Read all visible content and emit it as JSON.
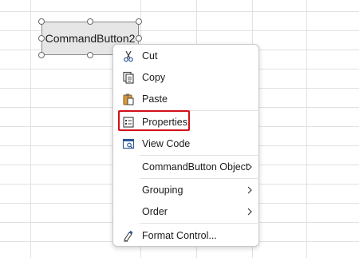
{
  "command_button": {
    "label": "CommandButton2"
  },
  "context_menu": {
    "items": [
      {
        "label": "Cut",
        "icon": "scissors-icon"
      },
      {
        "label": "Copy",
        "icon": "copy-icon"
      },
      {
        "label": "Paste",
        "icon": "paste-icon"
      },
      {
        "label": "Properties",
        "icon": "properties-icon",
        "highlighted": true
      },
      {
        "label": "View Code",
        "icon": "view-code-icon"
      },
      {
        "label": "CommandButton Object",
        "submenu": true
      },
      {
        "label": "Grouping",
        "submenu": true
      },
      {
        "label": "Order",
        "submenu": true
      },
      {
        "label": "Format Control...",
        "icon": "format-control-icon"
      }
    ]
  },
  "colors": {
    "highlight_border": "#d1101a",
    "grid_line": "#e1e1e1",
    "button_fill": "#e6e6e6"
  }
}
